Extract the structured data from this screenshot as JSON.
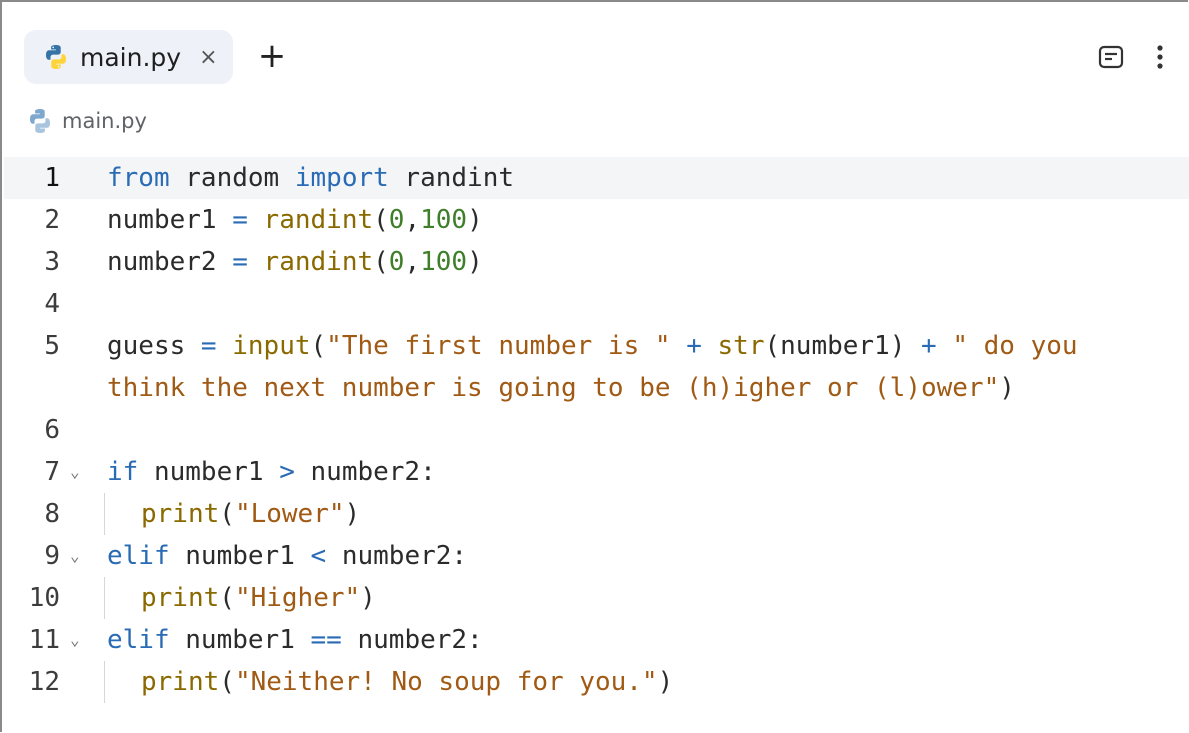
{
  "tabs": [
    {
      "label": "main.py",
      "close": "×",
      "icon": "python-icon"
    }
  ],
  "tabbar": {
    "new_tab": "+"
  },
  "breadcrumb": {
    "label": "main.py",
    "icon": "python-icon"
  },
  "colors": {
    "keyword": "#2a6bb5",
    "function": "#8a6a00",
    "number": "#3f7f2a",
    "string": "#a05a14",
    "python_blue": "#3572A5",
    "python_yellow": "#FFD43B"
  },
  "editor": {
    "active_line": 1,
    "lines": [
      {
        "n": "1",
        "tokens": [
          [
            "kw",
            "from"
          ],
          [
            "pl",
            " random "
          ],
          [
            "kw",
            "import"
          ],
          [
            "pl",
            " randint"
          ]
        ]
      },
      {
        "n": "2",
        "tokens": [
          [
            "pl",
            "number1 "
          ],
          [
            "op",
            "="
          ],
          [
            "pl",
            " "
          ],
          [
            "fn",
            "randint"
          ],
          [
            "pl",
            "("
          ],
          [
            "num",
            "0"
          ],
          [
            "pl",
            ","
          ],
          [
            "num",
            "100"
          ],
          [
            "pl",
            ")"
          ]
        ]
      },
      {
        "n": "3",
        "tokens": [
          [
            "pl",
            "number2 "
          ],
          [
            "op",
            "="
          ],
          [
            "pl",
            " "
          ],
          [
            "fn",
            "randint"
          ],
          [
            "pl",
            "("
          ],
          [
            "num",
            "0"
          ],
          [
            "pl",
            ","
          ],
          [
            "num",
            "100"
          ],
          [
            "pl",
            ")"
          ]
        ]
      },
      {
        "n": "4",
        "tokens": []
      },
      {
        "n": "5",
        "tokens": [
          [
            "pl",
            "guess "
          ],
          [
            "op",
            "="
          ],
          [
            "pl",
            " "
          ],
          [
            "fn",
            "input"
          ],
          [
            "pl",
            "("
          ],
          [
            "str",
            "\"The first number is \""
          ],
          [
            "pl",
            " "
          ],
          [
            "op",
            "+"
          ],
          [
            "pl",
            " "
          ],
          [
            "fn",
            "str"
          ],
          [
            "pl",
            "(number1) "
          ],
          [
            "op",
            "+"
          ],
          [
            "pl",
            " "
          ],
          [
            "str",
            "\" do you"
          ]
        ]
      },
      {
        "n": "",
        "tokens": [
          [
            "str",
            "think the next number is going to be (h)igher or (l)ower\""
          ],
          [
            "pl",
            ")"
          ]
        ]
      },
      {
        "n": "6",
        "tokens": []
      },
      {
        "n": "7",
        "fold": "⌄",
        "tokens": [
          [
            "kw",
            "if"
          ],
          [
            "pl",
            " number1 "
          ],
          [
            "op",
            ">"
          ],
          [
            "pl",
            " number2:"
          ]
        ]
      },
      {
        "n": "8",
        "indent": true,
        "tokens": [
          [
            "fn",
            "print"
          ],
          [
            "pl",
            "("
          ],
          [
            "str",
            "\"Lower\""
          ],
          [
            "pl",
            ")"
          ]
        ]
      },
      {
        "n": "9",
        "fold": "⌄",
        "tokens": [
          [
            "kw",
            "elif"
          ],
          [
            "pl",
            " number1 "
          ],
          [
            "op",
            "<"
          ],
          [
            "pl",
            " number2:"
          ]
        ]
      },
      {
        "n": "10",
        "indent": true,
        "tokens": [
          [
            "fn",
            "print"
          ],
          [
            "pl",
            "("
          ],
          [
            "str",
            "\"Higher\""
          ],
          [
            "pl",
            ")"
          ]
        ]
      },
      {
        "n": "11",
        "fold": "⌄",
        "tokens": [
          [
            "kw",
            "elif"
          ],
          [
            "pl",
            " number1 "
          ],
          [
            "op",
            "=="
          ],
          [
            "pl",
            " number2:"
          ]
        ]
      },
      {
        "n": "12",
        "indent": true,
        "tokens": [
          [
            "fn",
            "print"
          ],
          [
            "pl",
            "("
          ],
          [
            "str",
            "\"Neither! No soup for you.\""
          ],
          [
            "pl",
            ")"
          ]
        ]
      }
    ]
  }
}
